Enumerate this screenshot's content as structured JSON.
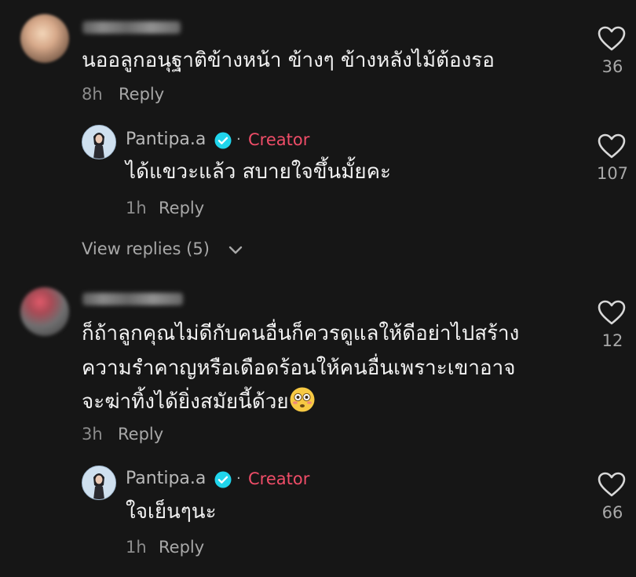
{
  "comments": [
    {
      "text": "นออลูกอนุฐาติข้างหน้า ข้างๆ ข้างหลังไม้ต้องรอ",
      "time": "8h",
      "reply_label": "Reply",
      "likes": "36"
    },
    {
      "text_lines": [
        "ก็ถ้าลูกคุณไม่ดีกับคนอื่นก็ควรดูแลให้ดีอย่าไปสร้าง",
        "ความรำคาญหรือเดือดร้อนให้คนอื่นเพราะเขาอาจ",
        "จะฆ่าทิ้งได้ยิ่งสมัยนี้ด้วย"
      ],
      "time": "3h",
      "reply_label": "Reply",
      "likes": "12"
    }
  ],
  "replies": [
    {
      "username": "Pantipa.a",
      "separator": "·",
      "badge": "Creator",
      "text": "ได้แขวะแล้ว สบายใจขึ้นมั้ยคะ",
      "time": "1h",
      "reply_label": "Reply",
      "likes": "107"
    },
    {
      "username": "Pantipa.a",
      "separator": "·",
      "badge": "Creator",
      "text": "ใจเย็นๆนะ",
      "time": "1h",
      "reply_label": "Reply",
      "likes": "66"
    }
  ],
  "view_replies": "View replies (5)",
  "colors": {
    "background": "#161616",
    "creator": "#ef4d68",
    "verified": "#20d5ec"
  },
  "icons": [
    "heart-icon",
    "verified-icon",
    "chevron-down-icon",
    "flushed-face-emoji"
  ]
}
